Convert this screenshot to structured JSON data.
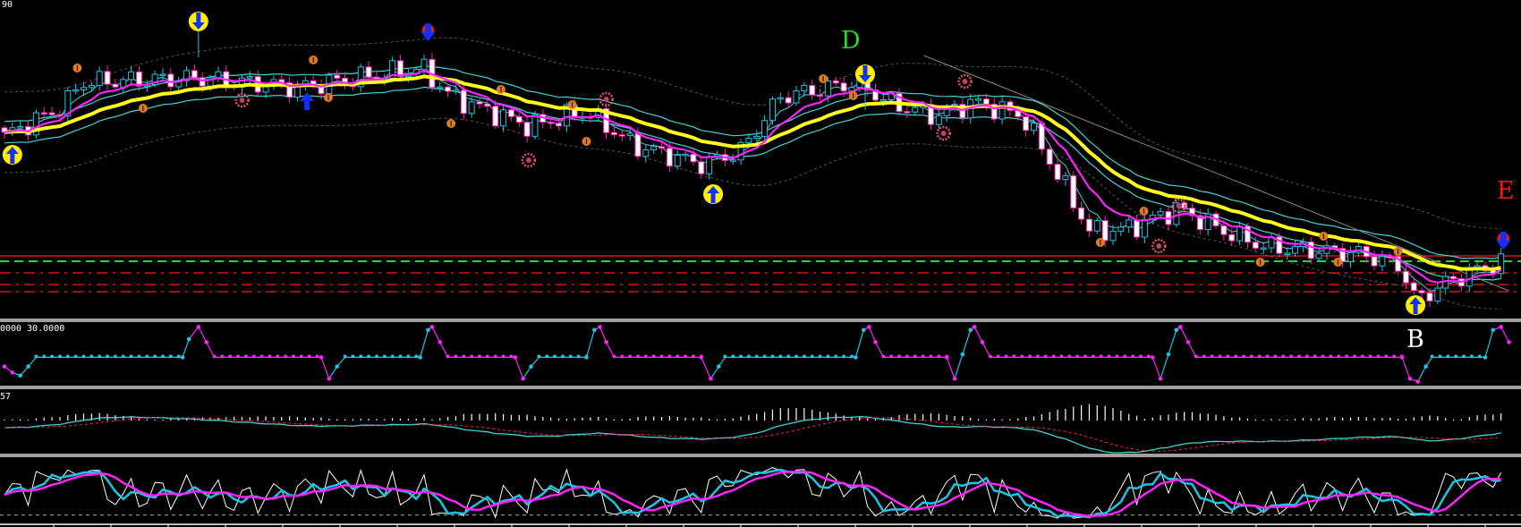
{
  "labels": {
    "main_scale_top": "90",
    "panel2_scale": "0000 30.0000",
    "panel3_scale": "57",
    "letter_d": "D",
    "letter_e": "E",
    "letter_b": "B"
  },
  "colors": {
    "background": "#000000",
    "bull": "#19c6e6",
    "bear": "#ff1fb4",
    "slow_ma": "#ffff1a",
    "fast_ma": "#ff22ff",
    "envelope": "#3fd6d6",
    "band": "#555555",
    "level_red": "#ff1a1a",
    "level_green": "#33cc33",
    "letter_d": "#22dd22",
    "letter_e": "#ff1010",
    "letter_b": "#ffffff",
    "orange": "#e07a20",
    "pink": "#e05070"
  },
  "chart_data": {
    "type": "candlestick",
    "bars": 190,
    "ylim": [
      1.2645,
      1.3
    ],
    "close_keypoints": [
      [
        0,
        1.2848
      ],
      [
        7.4,
        1.2881
      ],
      [
        9.8,
        1.2908
      ],
      [
        24.5,
        1.2913
      ],
      [
        36.8,
        1.2902
      ],
      [
        52.7,
        1.2924
      ],
      [
        56.4,
        1.2892
      ],
      [
        66.2,
        1.2859
      ],
      [
        73.5,
        1.2875
      ],
      [
        79.6,
        1.2837
      ],
      [
        88.2,
        1.2816
      ],
      [
        93.1,
        1.2832
      ],
      [
        98,
        1.2892
      ],
      [
        107.8,
        1.2908
      ],
      [
        111.5,
        1.2886
      ],
      [
        117.6,
        1.287
      ],
      [
        122.5,
        1.2886
      ],
      [
        128.6,
        1.287
      ],
      [
        132.3,
        1.2816
      ],
      [
        137.2,
        1.274
      ],
      [
        142.1,
        1.2745
      ],
      [
        148.2,
        1.2767
      ],
      [
        154.4,
        1.274
      ],
      [
        159.3,
        1.2724
      ],
      [
        171.5,
        1.2716
      ],
      [
        176.4,
        1.2702
      ],
      [
        178.2,
        1.2664
      ],
      [
        182.5,
        1.2686
      ],
      [
        190,
        1.271
      ]
    ],
    "levels": [
      {
        "price": 1.2714,
        "style": "solid",
        "color": "red"
      },
      {
        "price": 1.2708,
        "style": "dash",
        "color": "green"
      },
      {
        "price": 1.2695,
        "style": "dashdot",
        "color": "red"
      },
      {
        "price": 1.2682,
        "style": "dashdot",
        "color": "red"
      },
      {
        "price": 1.2674,
        "style": "dashdot",
        "color": "red"
      }
    ],
    "trendline": [
      [
        116.1,
        1.2938
      ],
      [
        190,
        1.2675
      ]
    ],
    "markers": [
      {
        "bar": 1,
        "price": 1.2827,
        "type": "buy-arrow"
      },
      {
        "bar": 24.5,
        "price": 1.2976,
        "type": "sell-arrow"
      },
      {
        "bar": 38.2,
        "price": 1.2887,
        "type": "up-arrow"
      },
      {
        "bar": 53.5,
        "price": 1.2964,
        "type": "down-arrow"
      },
      {
        "bar": 108.7,
        "price": 1.2917,
        "type": "sell-arrow"
      },
      {
        "bar": 89.5,
        "price": 1.2783,
        "type": "buy-arrow"
      },
      {
        "bar": 178.2,
        "price": 1.2659,
        "type": "buy-arrow"
      },
      {
        "bar": 189.3,
        "price": 1.2731,
        "type": "down-arrow"
      },
      {
        "bar": 9.2,
        "price": 1.2924,
        "type": "orange-dot"
      },
      {
        "bar": 17.5,
        "price": 1.2879,
        "type": "orange-dot"
      },
      {
        "bar": 39,
        "price": 1.2933,
        "type": "orange-dot"
      },
      {
        "bar": 40.9,
        "price": 1.2891,
        "type": "orange-dot"
      },
      {
        "bar": 56.4,
        "price": 1.2862,
        "type": "orange-dot"
      },
      {
        "bar": 62.7,
        "price": 1.29,
        "type": "orange-dot"
      },
      {
        "bar": 71.7,
        "price": 1.2883,
        "type": "orange-dot"
      },
      {
        "bar": 73.5,
        "price": 1.2842,
        "type": "orange-dot"
      },
      {
        "bar": 103.4,
        "price": 1.2912,
        "type": "orange-dot"
      },
      {
        "bar": 107.2,
        "price": 1.2893,
        "type": "orange-dot"
      },
      {
        "bar": 143.9,
        "price": 1.2764,
        "type": "orange-dot"
      },
      {
        "bar": 138.4,
        "price": 1.2729,
        "type": "orange-dot"
      },
      {
        "bar": 166.6,
        "price": 1.2736,
        "type": "orange-dot"
      },
      {
        "bar": 158.6,
        "price": 1.2707,
        "type": "orange-dot"
      },
      {
        "bar": 168.4,
        "price": 1.2707,
        "type": "orange-dot"
      },
      {
        "bar": 176,
        "price": 1.2719,
        "type": "orange-dot"
      },
      {
        "bar": 30,
        "price": 1.2888,
        "type": "pink-gear"
      },
      {
        "bar": 66.2,
        "price": 1.2821,
        "type": "pink-gear"
      },
      {
        "bar": 76,
        "price": 1.2889,
        "type": "pink-gear"
      },
      {
        "bar": 118.6,
        "price": 1.2851,
        "type": "pink-gear"
      },
      {
        "bar": 121.3,
        "price": 1.2909,
        "type": "pink-gear"
      },
      {
        "bar": 145.8,
        "price": 1.2725,
        "type": "pink-gear"
      },
      {
        "bar": 148.3,
        "price": 1.277,
        "type": "pink-gear"
      }
    ],
    "step_oscillator": {
      "ylim": [
        0,
        100
      ],
      "points": [
        [
          0,
          30,
          "m"
        ],
        [
          1,
          20,
          "m"
        ],
        [
          2,
          15,
          "c"
        ],
        [
          3,
          30,
          "c"
        ],
        [
          4,
          45,
          "c"
        ],
        [
          22.5,
          45,
          "c"
        ],
        [
          23.3,
          75,
          "c"
        ],
        [
          24.5,
          95,
          "m"
        ],
        [
          25.5,
          70,
          "m"
        ],
        [
          26.5,
          45,
          "m"
        ],
        [
          40,
          45,
          "m"
        ],
        [
          41,
          10,
          "m"
        ],
        [
          42,
          30,
          "c"
        ],
        [
          43,
          45,
          "c"
        ],
        [
          52.5,
          45,
          "c"
        ],
        [
          53.5,
          90,
          "c"
        ],
        [
          54,
          95,
          "m"
        ],
        [
          55,
          70,
          "m"
        ],
        [
          56,
          45,
          "m"
        ],
        [
          64.5,
          45,
          "m"
        ],
        [
          65.5,
          10,
          "m"
        ],
        [
          66.5,
          30,
          "c"
        ],
        [
          67.5,
          45,
          "c"
        ],
        [
          73.5,
          45,
          "c"
        ],
        [
          74.5,
          90,
          "c"
        ],
        [
          75.2,
          95,
          "m"
        ],
        [
          76,
          70,
          "m"
        ],
        [
          77,
          45,
          "m"
        ],
        [
          88,
          45,
          "m"
        ],
        [
          89.2,
          10,
          "m"
        ],
        [
          90.2,
          30,
          "c"
        ],
        [
          91,
          45,
          "c"
        ],
        [
          107.5,
          45,
          "c"
        ],
        [
          108.5,
          90,
          "c"
        ],
        [
          109.2,
          95,
          "m"
        ],
        [
          110,
          70,
          "m"
        ],
        [
          111,
          45,
          "m"
        ],
        [
          119,
          45,
          "m"
        ],
        [
          120,
          10,
          "m"
        ],
        [
          121,
          50,
          "c"
        ],
        [
          122,
          90,
          "c"
        ],
        [
          122.5,
          95,
          "m"
        ],
        [
          123.5,
          70,
          "m"
        ],
        [
          124.5,
          45,
          "m"
        ],
        [
          145,
          45,
          "m"
        ],
        [
          146,
          10,
          "m"
        ],
        [
          147,
          50,
          "c"
        ],
        [
          148,
          90,
          "c"
        ],
        [
          148.5,
          95,
          "m"
        ],
        [
          149.5,
          70,
          "m"
        ],
        [
          150.5,
          45,
          "m"
        ],
        [
          176.5,
          45,
          "m"
        ],
        [
          177.5,
          10,
          "m"
        ],
        [
          178.5,
          5,
          "m"
        ],
        [
          179.5,
          30,
          "c"
        ],
        [
          180.3,
          45,
          "c"
        ],
        [
          187,
          45,
          "c"
        ],
        [
          188,
          90,
          "c"
        ],
        [
          189,
          95,
          "m"
        ],
        [
          190,
          70,
          "m"
        ]
      ]
    },
    "macd": {
      "fast": 12,
      "slow": 26,
      "signal": 9
    },
    "stochastic": {
      "k": 5,
      "d": 3,
      "slowing": 5,
      "level": 20
    }
  }
}
